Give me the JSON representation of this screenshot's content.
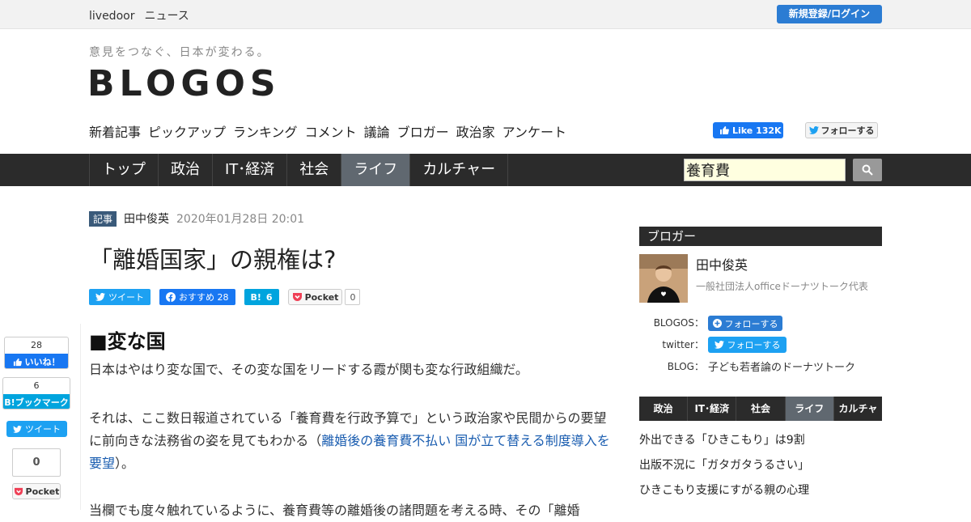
{
  "topbar": {
    "brand_1": "livedoor",
    "brand_2": "ニュース",
    "login": "新規登録/ログイン"
  },
  "header": {
    "tagline": "意見をつなぐ、日本が変わる。",
    "logo": "BLOGOS",
    "subnav": [
      "新着記事",
      "ピックアップ",
      "ランキング",
      "コメント",
      "議論",
      "ブロガー",
      "政治家",
      "アンケート"
    ],
    "fb_like": "Like 132K",
    "tw_follow": "フォローする"
  },
  "mainnav": {
    "items": [
      "トップ",
      "政治",
      "IT･経済",
      "社会",
      "ライフ",
      "カルチャー"
    ],
    "active": "ライフ"
  },
  "search": {
    "value": "養育費"
  },
  "article": {
    "tag": "記事",
    "author": "田中俊英",
    "date": "2020年01月28日 20:01",
    "title": "「離婚国家」の親権は?",
    "share": {
      "tweet": "ツイート",
      "fb": "おすすめ 28",
      "hb": "6",
      "pocket": "Pocket",
      "pocket_count": "0"
    },
    "heading": "■変な国",
    "p1": "日本はやはり変な国で、その変な国をリードする霞が関も変な行政組織だ。",
    "p2_before": "それは、ここ数日報道されている「養育費を行政予算で」という政治家や民間からの要望に前向きな法務省の姿を見てもわかる（",
    "p2_link": "離婚後の養育費不払い 国が立て替える制度導入を要望",
    "p2_after": "）。",
    "p3": "当欄でも度々触れているように、養育費等の離婚後の諸問題を考える時、その「離婚"
  },
  "float_share": {
    "fb_count": "28",
    "fb_label": "いいね！",
    "hb_count": "6",
    "hb_label": "ブックマーク",
    "tweet": "ツイート",
    "pocket_count": "0",
    "pocket": "Pocket"
  },
  "sidebar": {
    "head": "ブロガー",
    "name": "田中俊英",
    "org": "一般社団法人officeドーナツトーク代表",
    "blogos_label": "BLOGOS：",
    "blogos_btn": "フォローする",
    "twitter_label": "twitter：",
    "twitter_btn": "フォローする",
    "blog_label": "BLOG：",
    "blog_value": "子ども若者論のドーナツトーク",
    "tabs": [
      "政治",
      "IT･経済",
      "社会",
      "ライフ",
      "カルチャー"
    ],
    "active_tab": "ライフ",
    "list": [
      "外出できる「ひきこもり」は9割",
      "出版不況に「ガタガタうるさい」",
      "ひきこもり支援にすがる親の心理"
    ]
  },
  "colors": {
    "nav_bg": "#2b2b2b",
    "active_nav": "#606870",
    "link": "#1a5db0",
    "facebook": "#1877f2",
    "twitter": "#1da1f2",
    "hatena": "#00a4de"
  }
}
